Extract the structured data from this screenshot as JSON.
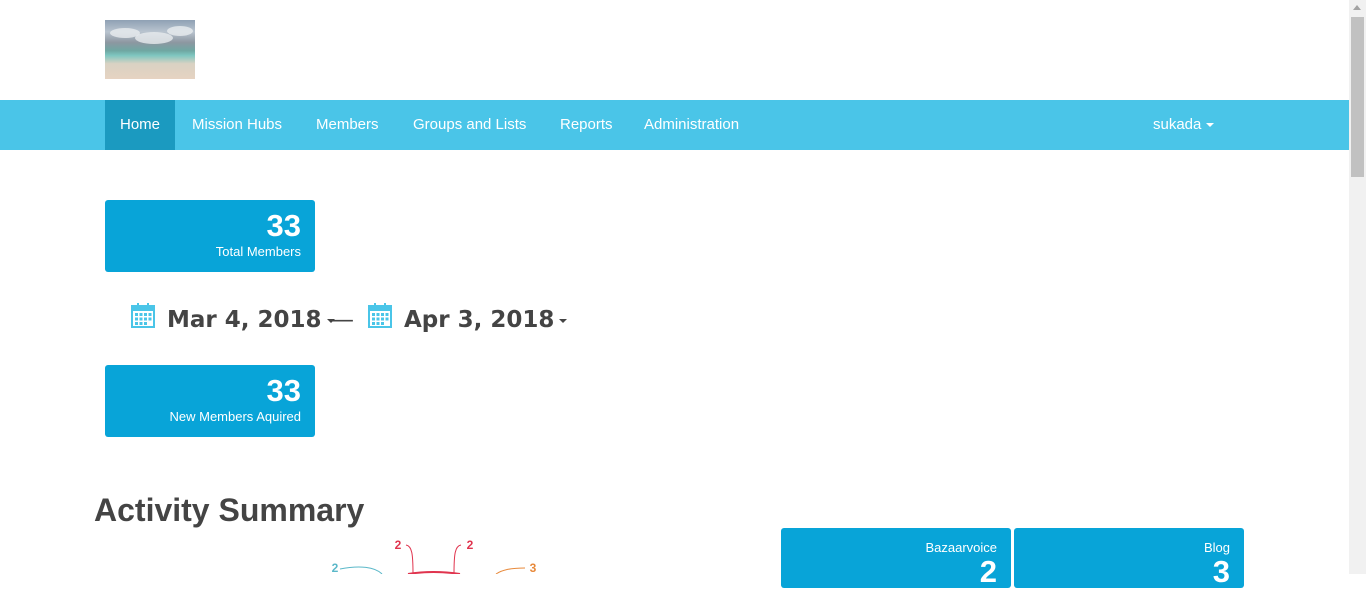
{
  "nav": {
    "items": [
      {
        "label": "Home",
        "active": true
      },
      {
        "label": "Mission Hubs"
      },
      {
        "label": "Members"
      },
      {
        "label": "Groups and Lists"
      },
      {
        "label": "Reports"
      },
      {
        "label": "Administration"
      }
    ],
    "user": "sukada"
  },
  "stats": {
    "total_members": {
      "value": "33",
      "label": "Total Members"
    },
    "new_members": {
      "value": "33",
      "label": "New Members Aquired"
    }
  },
  "date_range": {
    "start": "Mar 4, 2018",
    "separator": "—",
    "end": "Apr 3, 2018"
  },
  "activity": {
    "title": "Activity Summary",
    "chart_labels": [
      {
        "value": "2",
        "color": "#5bb8c9"
      },
      {
        "value": "2",
        "color": "#e0344e"
      },
      {
        "value": "2",
        "color": "#e0344e"
      },
      {
        "value": "3",
        "color": "#e8893a"
      }
    ],
    "channels": [
      {
        "label": "Bazaarvoice",
        "value": "2"
      },
      {
        "label": "Blog",
        "value": "3"
      }
    ]
  },
  "colors": {
    "navbar": "#4ac5e8",
    "nav_active": "#1b9ac0",
    "stat_box": "#08a4d8"
  },
  "icons": {
    "calendar": "calendar-icon",
    "dropdown": "caret-down-icon"
  }
}
